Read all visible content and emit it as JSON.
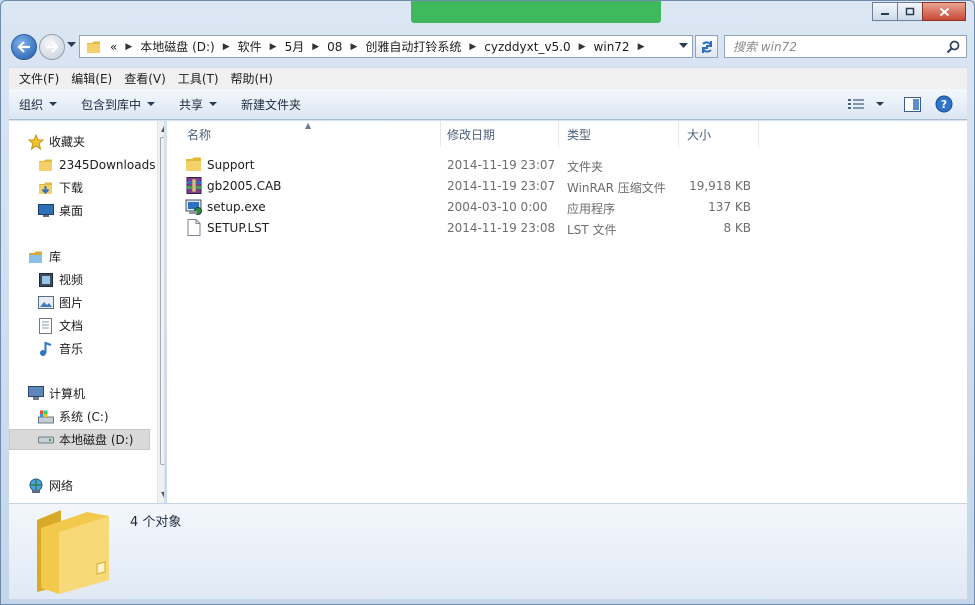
{
  "address": {
    "crumbs": [
      "«",
      "本地磁盘 (D:)",
      "软件",
      "5月",
      "08",
      "创雅自动打铃系统",
      "cyzddyxt_v5.0",
      "win72"
    ]
  },
  "search": {
    "placeholder": "搜索 win72"
  },
  "menu": [
    "文件(F)",
    "编辑(E)",
    "查看(V)",
    "工具(T)",
    "帮助(H)"
  ],
  "toolbar": {
    "organize": "组织",
    "include_library": "包含到库中",
    "share": "共享",
    "new_folder": "新建文件夹"
  },
  "nav": {
    "favorites": "收藏夹",
    "fav_items": [
      "2345Downloads",
      "下载",
      "桌面"
    ],
    "libraries": "库",
    "lib_items": [
      "视频",
      "图片",
      "文档",
      "音乐"
    ],
    "computer": "计算机",
    "drives": [
      "系统 (C:)",
      "本地磁盘 (D:)"
    ],
    "network": "网络"
  },
  "columns": {
    "name": "名称",
    "date": "修改日期",
    "type": "类型",
    "size": "大小"
  },
  "files": [
    {
      "name": "Support",
      "date": "2014-11-19 23:07",
      "type": "文件夹",
      "size": "",
      "icon": "folder-icon"
    },
    {
      "name": "gb2005.CAB",
      "date": "2014-11-19 23:07",
      "type": "WinRAR 压缩文件",
      "size": "19,918 KB",
      "icon": "winrar-icon"
    },
    {
      "name": "setup.exe",
      "date": "2004-03-10 0:00",
      "type": "应用程序",
      "size": "137 KB",
      "icon": "setup-exe-icon"
    },
    {
      "name": "SETUP.LST",
      "date": "2014-11-19 23:08",
      "type": "LST 文件",
      "size": "8 KB",
      "icon": "document-icon"
    }
  ],
  "status": {
    "count": "4 个对象"
  },
  "colors": {
    "selection": "#d9d9d9",
    "header_text": "#4c607a",
    "folder": "#f2c94c"
  }
}
